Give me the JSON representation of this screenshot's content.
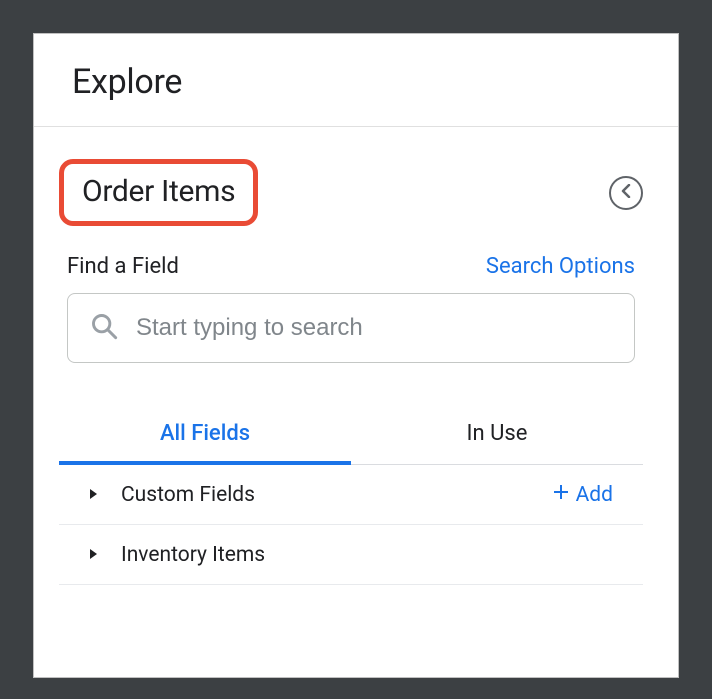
{
  "header": {
    "title": "Explore"
  },
  "section": {
    "title": "Order Items",
    "find_label": "Find a Field",
    "search_options": "Search Options",
    "search_placeholder": "Start typing to search"
  },
  "tabs": {
    "all_fields": "All Fields",
    "in_use": "In Use"
  },
  "rows": {
    "custom_fields": "Custom Fields",
    "inventory_items": "Inventory Items",
    "add_label": "Add"
  },
  "colors": {
    "accent": "#1a73e8",
    "highlight": "#e94b35"
  }
}
